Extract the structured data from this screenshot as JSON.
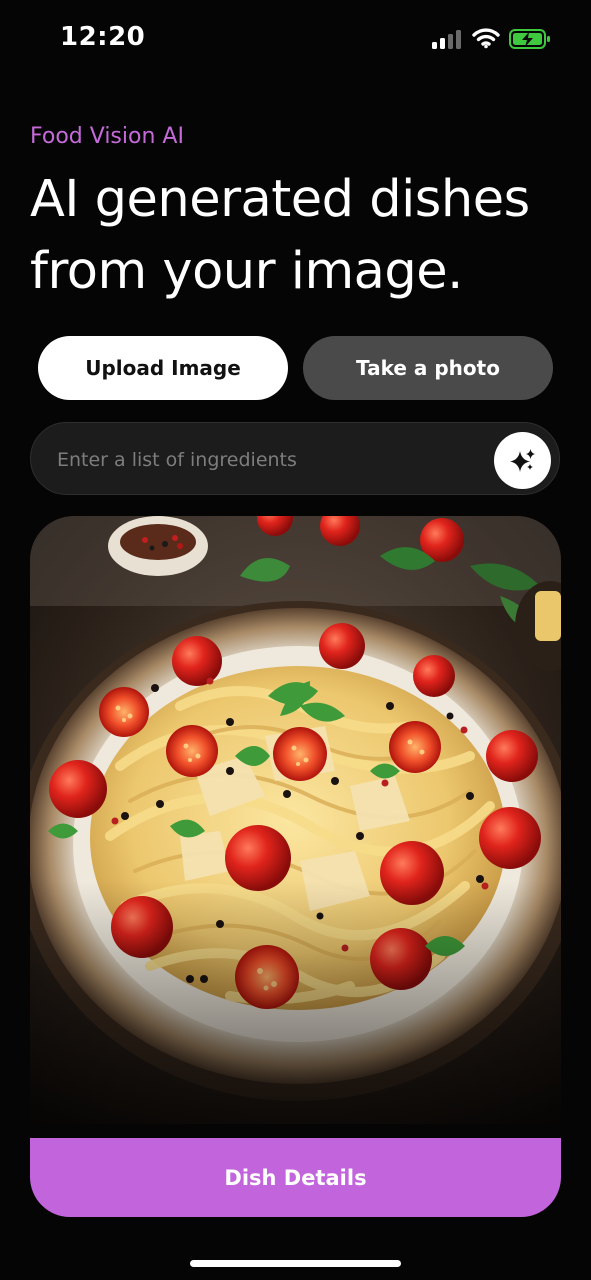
{
  "status_bar": {
    "time": "12:20"
  },
  "app": {
    "brand": "Food Vision AI",
    "headline": "AI generated dishes from your image."
  },
  "actions": {
    "upload_label": "Upload Image",
    "photo_label": "Take a photo"
  },
  "ingredients": {
    "value": "",
    "placeholder": "Enter a list of ingredients"
  },
  "dish": {
    "button_label": "Dish Details"
  },
  "colors": {
    "accent": "#c264dc",
    "brand_text": "#c46bd9",
    "background": "#050505",
    "secondary_button": "#4a4a4a"
  },
  "icons": {
    "generate": "sparkle-icon",
    "signal": "cellular-signal-icon",
    "wifi": "wifi-icon",
    "battery": "battery-charging-icon"
  }
}
